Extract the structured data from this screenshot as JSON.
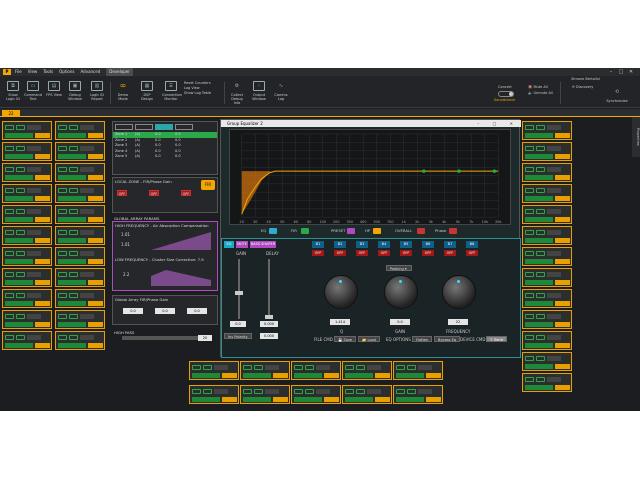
{
  "menu": {
    "items": [
      "File",
      "View",
      "Tools",
      "Options",
      "Advanced",
      "Developer"
    ],
    "active": "Developer"
  },
  "ribbon": {
    "buttons": [
      {
        "label": "Show Logic ID",
        "icon": "id-icon"
      },
      {
        "label": "Command Test",
        "icon": "terminal-icon"
      },
      {
        "label": "FPS View",
        "icon": "fps-icon"
      },
      {
        "label": "Debug Window",
        "icon": "window-icon"
      },
      {
        "label": "Logic ID Report",
        "icon": "report-icon"
      },
      {
        "label": "Demo Mode",
        "icon": "infinity-icon"
      },
      {
        "label": "DSP Design",
        "icon": "dsp-icon"
      },
      {
        "label": "Connection Monitor",
        "icon": "monitor-icon"
      },
      {
        "label": "Collect Debug Info",
        "icon": "gear-icon"
      },
      {
        "label": "Output Window",
        "icon": "output-icon"
      },
      {
        "label": "Comms Log",
        "icon": "pulse-icon"
      }
    ],
    "small_items": [
      "Reset Counters",
      "Log View",
      "Show Log Table"
    ],
    "right": {
      "concert": "Concert",
      "soundcheck": "Soundcheck",
      "mute_all": "Mute All",
      "unmute_all": "Unmute All",
      "discovery": "Discovery",
      "synchronize": "Synchronize"
    },
    "user": "Simone Bertolini"
  },
  "tab": {
    "label": "22"
  },
  "left_panel": {
    "zones": [
      {
        "name": "Zone 1",
        "a": "(A)",
        "b": "0.0",
        "c": "0.0"
      },
      {
        "name": "Zone 2",
        "a": "(A)",
        "b": "0.0",
        "c": "0.0"
      },
      {
        "name": "Zone 3",
        "a": "(A)",
        "b": "0.0",
        "c": "0.0"
      },
      {
        "name": "Zone 4",
        "a": "(A)",
        "b": "0.0",
        "c": "0.0"
      },
      {
        "name": "Zone 5",
        "a": "(A)",
        "b": "0.0",
        "c": "0.0"
      }
    ],
    "local_zone_title": "LOCAL ZONE - FIR/Phase Gain",
    "off_label": "OFF",
    "global_array": "GLOBAL ARRAY PARAMS",
    "hf_title": "HIGH FREQUENCY - Air Absorption Compensation",
    "hf_values": [
      "1.01",
      "1.01"
    ],
    "lf_title": "LOW FREQUENCY - Cluster Size Correction: 7.9",
    "lf_value": "2.2",
    "global_fir": "Global Array FIR/Phase Gain",
    "global_fir_values": [
      "0.0",
      "0.0",
      "0.0"
    ],
    "high_pass": "HIGH PASS",
    "high_pass_value": "20"
  },
  "eq": {
    "title": "Group Equalizer 2",
    "x_ticks": [
      "20",
      "30",
      "40",
      "50",
      "60",
      "80",
      "100",
      "200",
      "300",
      "400",
      "500",
      "700",
      "1k",
      "2k",
      "3k",
      "4k",
      "5k",
      "7k",
      "10k",
      "20k"
    ],
    "filters": {
      "eq": "EQ",
      "fir": "FIR",
      "preset": "PRESET",
      "hp": "HP",
      "overall": "OVERALL",
      "phase": "Phase"
    },
    "modes": [
      "EQ",
      "MUTE",
      "BASS SHAPER"
    ],
    "bands": [
      "B1",
      "B2",
      "B3",
      "B4",
      "B5",
      "B6",
      "B7",
      "B8"
    ],
    "gain_label": "GAIN",
    "delay_label": "DELAY",
    "gain_val": "0.0",
    "delay_val": "0.000",
    "delay_val2": "0.000",
    "invert_label": "Inv Polarity",
    "filter_type": "Peaking",
    "q_label": "Q",
    "q_val": "1.414",
    "g_val": "0.0",
    "f_val": "22",
    "gain_knob_label": "GAIN",
    "freq_knob_label": "FREQUENCY",
    "file_cmd": "FILE CMD",
    "save": "Save",
    "load": "Load",
    "eq_options": "EQ OPTIONS",
    "flatten": "Flatten",
    "bypass": "Bypass Eq",
    "device_cmd": "DEVICE CMD",
    "send": "Send"
  },
  "colors": {
    "accent": "#f4a700",
    "green": "#2aa84a",
    "blue": "#0e5f8a",
    "red": "#a01818",
    "teal": "#2f8f8f"
  },
  "side_panel": {
    "label": "Properties"
  }
}
